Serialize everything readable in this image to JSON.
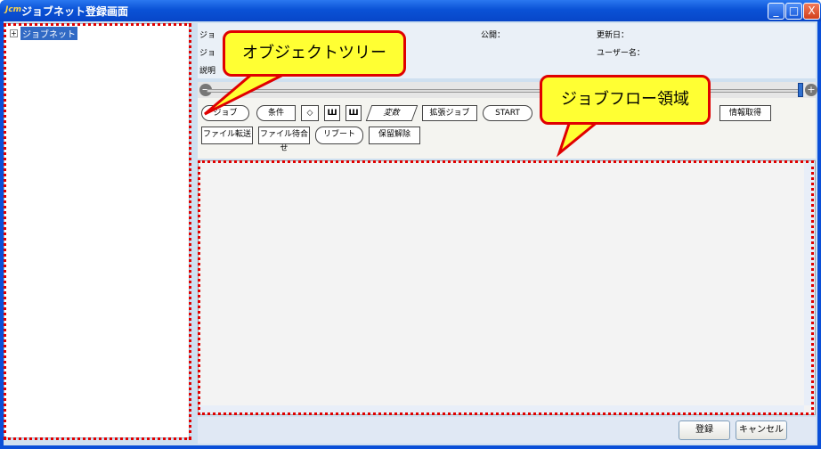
{
  "window": {
    "title": "ジョブネット登録画面",
    "logo": "Jcm",
    "minimize": "_",
    "maximize": "□",
    "close": "X"
  },
  "tree": {
    "root_label": "ジョブネット",
    "expand": "+"
  },
  "info": {
    "job_id_label": "ジョ",
    "job_name_label": "ジョ",
    "desc_label": "説明",
    "public_label": "公開：",
    "updated_label": "更新日：",
    "user_label": "ユーザー名："
  },
  "slider": {
    "min": "−",
    "max": "+",
    "level_pct": 100
  },
  "palette": {
    "job": "ジョブ",
    "condition": "条件",
    "variable": "変数",
    "ext_job": "拡張ジョブ",
    "start": "START",
    "info_get": "情報取得",
    "file_transfer": "ファイル転送",
    "file_wait": "ファイル待合せ",
    "reboot": "リブート",
    "release": "保留解除"
  },
  "buttons": {
    "register": "登録",
    "cancel": "キャンセル"
  },
  "callouts": {
    "tree": "オブジェクトツリー",
    "flow": "ジョブフロー領域"
  },
  "colors": {
    "title_blue": "#0a52d6",
    "callout_fill": "#ffff33",
    "callout_border": "#e00000"
  }
}
